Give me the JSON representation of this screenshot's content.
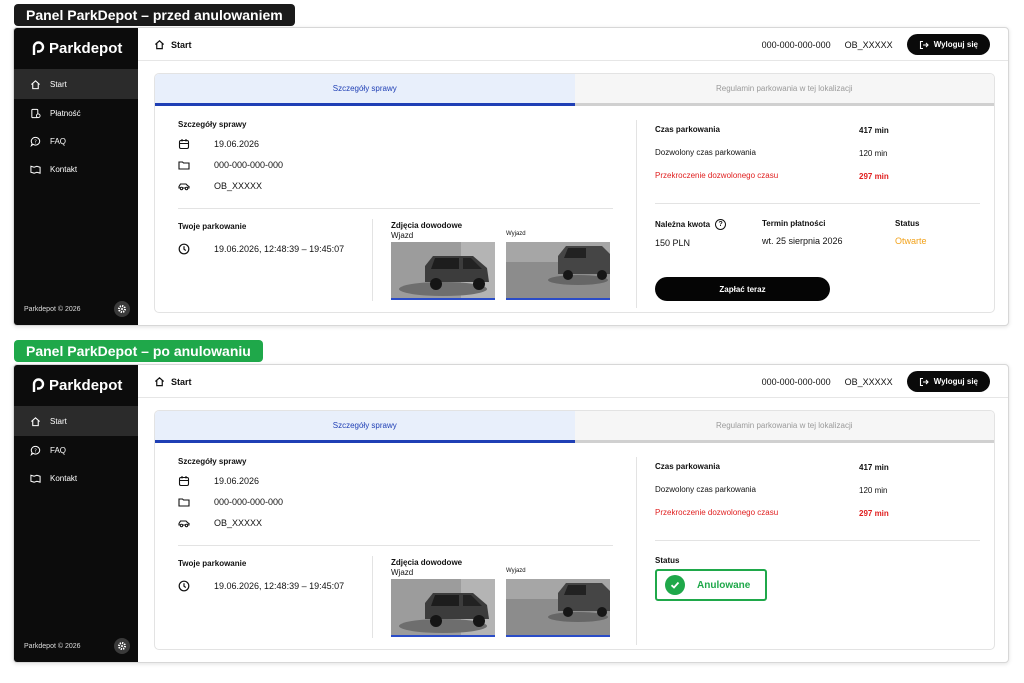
{
  "captions": {
    "before": "Panel ParkDepot – przed anulowaniem",
    "after": "Panel ParkDepot – po anulowaniu"
  },
  "colors": {
    "accent": "#1f3fb5",
    "success": "#1fa84a",
    "danger": "#e02020",
    "warning": "#f2a21b",
    "sidebar": "#0c0c0c"
  },
  "app": {
    "logo": "Parkdepot",
    "footer": "Parkdepot © 2026",
    "breadcrumb": "Start",
    "case_number": "000-000-000-000",
    "plate": "OB_XXXXX",
    "logout": "Wyloguj się"
  },
  "nav_before": [
    {
      "label": "Start",
      "icon": "home-icon"
    },
    {
      "label": "Płatność",
      "icon": "payment-icon"
    },
    {
      "label": "FAQ",
      "icon": "chat-question-icon"
    },
    {
      "label": "Kontakt",
      "icon": "contact-icon"
    }
  ],
  "nav_after": [
    {
      "label": "Start",
      "icon": "home-icon"
    },
    {
      "label": "FAQ",
      "icon": "chat-question-icon"
    },
    {
      "label": "Kontakt",
      "icon": "contact-icon"
    }
  ],
  "tabs": {
    "details": "Szczegóły sprawy",
    "rules": "Regulamin parkowania w tej lokalizacji"
  },
  "details": {
    "heading": "Szczegóły sprawy",
    "date": "19.06.2026",
    "case_number": "000-000-000-000",
    "plate": "OB_XXXXX"
  },
  "parking": {
    "heading": "Twoje parkowanie",
    "time": "19.06.2026, 12:48:39 – 19:45:07"
  },
  "photos": {
    "heading": "Zdjęcia dowodowe",
    "entry": "Wjazd",
    "exit": "Wyjazd"
  },
  "summary": {
    "parking_time_label": "Czas parkowania",
    "parking_time": "417 min",
    "allowed_label": "Dozwolony czas parkowania",
    "allowed": "120 min",
    "overtime_label": "Przekroczenie dozwolonego czasu",
    "overtime": "297 min"
  },
  "payment": {
    "amount_label": "Należna kwota",
    "amount": "150 PLN",
    "deadline_label": "Termin płatności",
    "deadline": "wt. 25 sierpnia 2026",
    "status_label": "Status",
    "status": "Otwarte",
    "pay_button": "Zapłać teraz"
  },
  "cancelled": {
    "status_label": "Status",
    "status": "Anulowane"
  }
}
